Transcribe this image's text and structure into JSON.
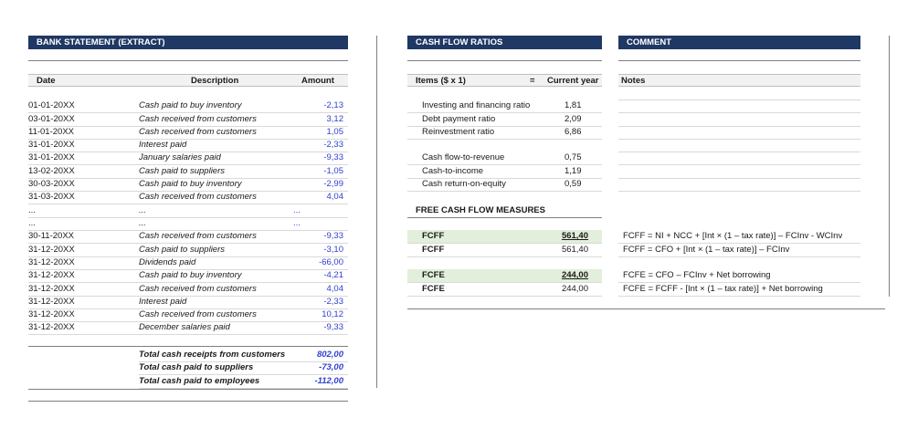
{
  "bank": {
    "title": "BANK STATEMENT (EXTRACT)",
    "col_date": "Date",
    "col_description": "Description",
    "col_amount": "Amount",
    "rows": [
      {
        "date": "01-01-20XX",
        "desc": "Cash paid to buy inventory",
        "amount": "-2,13"
      },
      {
        "date": "03-01-20XX",
        "desc": "Cash received from customers",
        "amount": "3,12"
      },
      {
        "date": "11-01-20XX",
        "desc": "Cash received from customers",
        "amount": "1,05"
      },
      {
        "date": "31-01-20XX",
        "desc": "Interest paid",
        "amount": "-2,33"
      },
      {
        "date": "31-01-20XX",
        "desc": "January salaries paid",
        "amount": "-9,33"
      },
      {
        "date": "13-02-20XX",
        "desc": "Cash paid to suppliers",
        "amount": "-1,05"
      },
      {
        "date": "30-03-20XX",
        "desc": "Cash paid to buy inventory",
        "amount": "-2,99"
      },
      {
        "date": "31-03-20XX",
        "desc": "Cash received from customers",
        "amount": "4,04"
      },
      {
        "date": "...",
        "desc": "...",
        "amount": "..."
      },
      {
        "date": "...",
        "desc": "...",
        "amount": "..."
      },
      {
        "date": "30-11-20XX",
        "desc": "Cash received from customers",
        "amount": "-9,33"
      },
      {
        "date": "31-12-20XX",
        "desc": "Cash paid to suppliers",
        "amount": "-3,10"
      },
      {
        "date": "31-12-20XX",
        "desc": "Dividends paid",
        "amount": "-66,00"
      },
      {
        "date": "31-12-20XX",
        "desc": "Cash paid to buy inventory",
        "amount": "-4,21"
      },
      {
        "date": "31-12-20XX",
        "desc": "Cash received from customers",
        "amount": "4,04"
      },
      {
        "date": "31-12-20XX",
        "desc": "Interest paid",
        "amount": "-2,33"
      },
      {
        "date": "31-12-20XX",
        "desc": "Cash received from customers",
        "amount": "10,12"
      },
      {
        "date": "31-12-20XX",
        "desc": "December salaries paid",
        "amount": "-9,33"
      }
    ],
    "totals": [
      {
        "label": "Total cash receipts from customers",
        "amount": "802,00"
      },
      {
        "label": "Total cash paid to suppliers",
        "amount": "-73,00"
      },
      {
        "label": "Total cash paid to employees",
        "amount": "-112,00"
      }
    ]
  },
  "ratios": {
    "title": "CASH FLOW RATIOS",
    "col_items": "Items ($ x 1)",
    "col_eq": "=",
    "col_current": "Current year",
    "group1": [
      {
        "label": "Investing and financing ratio",
        "value": "1,81"
      },
      {
        "label": "Debt payment ratio",
        "value": "2,09"
      },
      {
        "label": "Reinvestment ratio",
        "value": "6,86"
      }
    ],
    "group2": [
      {
        "label": "Cash flow-to-revenue",
        "value": "0,75"
      },
      {
        "label": "Cash-to-income",
        "value": "1,19"
      },
      {
        "label": "Cash return-on-equity",
        "value": "0,59"
      }
    ],
    "fcf_title": "FREE CASH FLOW MEASURES",
    "fcf_rows": [
      {
        "label": "FCFF",
        "value": "561,40",
        "note": "FCFF = NI + NCC + [Int × (1 – tax rate)] – FCInv - WCInv"
      },
      {
        "label": "FCFF",
        "value": "561,40",
        "note": "FCFF = CFO + [Int × (1 – tax rate)] – FCInv"
      },
      {
        "label": "FCFE",
        "value": "244,00",
        "note": "FCFE = CFO – FCInv + Net borrowing"
      },
      {
        "label": "FCFE",
        "value": "244,00",
        "note": "FCFE = FCFF - [Int × (1 – tax rate)] + Net borrowing"
      }
    ]
  },
  "comment": {
    "title": "COMMENT",
    "col_notes": "Notes"
  },
  "colors": {
    "header_bg": "#1f3864",
    "header_text": "#ffffff",
    "accent_blue": "#2f3fd0",
    "highlight_green": "#e2efda"
  }
}
